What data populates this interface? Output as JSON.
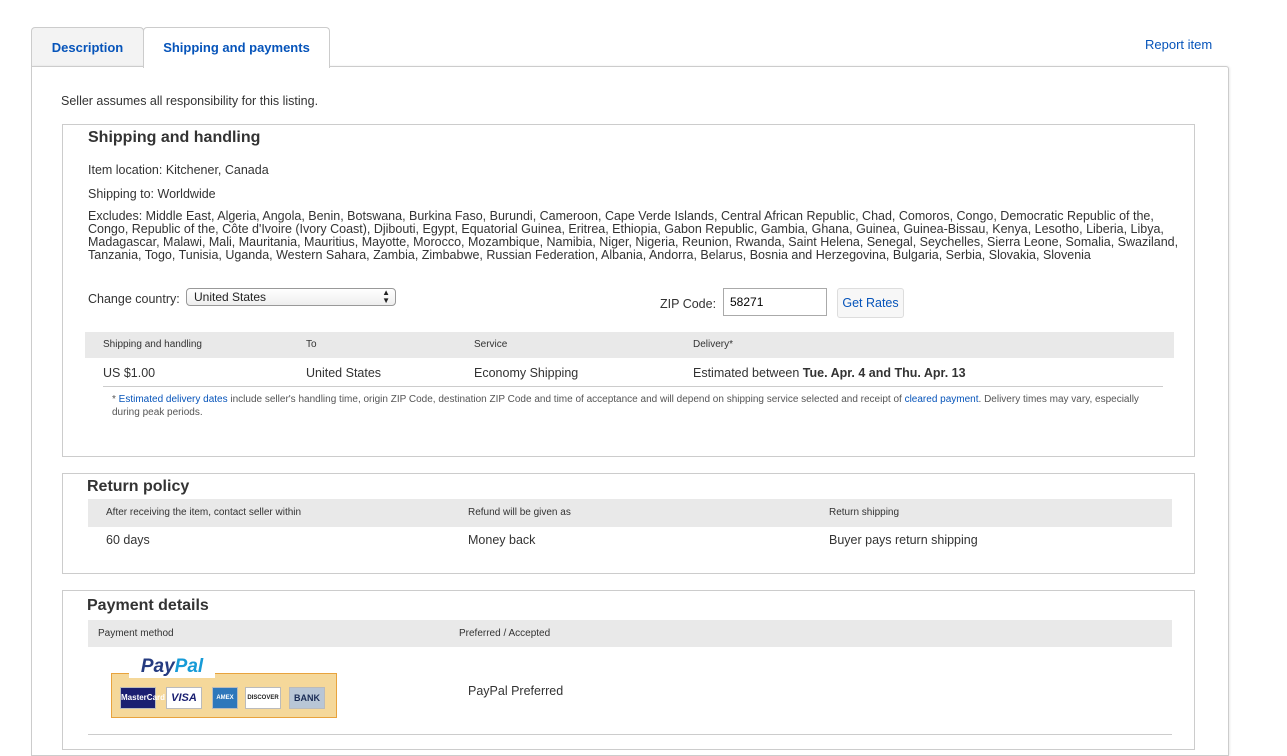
{
  "tabs": [
    {
      "label": "Description"
    },
    {
      "label": "Shipping and payments"
    }
  ],
  "report_link": "Report item",
  "seller_note": "Seller assumes all responsibility for this listing.",
  "shipping": {
    "title": "Shipping and handling",
    "item_location": "Item location: Kitchener, Canada",
    "shipping_to": "Shipping to: Worldwide",
    "excludes": "Excludes: Middle East, Algeria, Angola, Benin, Botswana, Burkina Faso, Burundi, Cameroon, Cape Verde Islands, Central African Republic, Chad, Comoros, Congo, Democratic Republic of the, Congo, Republic of the, Côte d'Ivoire (Ivory Coast), Djibouti, Egypt, Equatorial Guinea, Eritrea, Ethiopia, Gabon Republic, Gambia, Ghana, Guinea, Guinea-Bissau, Kenya, Lesotho, Liberia, Libya, Madagascar, Malawi, Mali, Mauritania, Mauritius, Mayotte, Morocco, Mozambique, Namibia, Niger, Nigeria, Reunion, Rwanda, Saint Helena, Senegal, Seychelles, Sierra Leone, Somalia, Swaziland, Tanzania, Togo, Tunisia, Uganda, Western Sahara, Zambia, Zimbabwe, Russian Federation, Albania, Andorra, Belarus, Bosnia and Herzegovina, Bulgaria, Serbia, Slovakia, Slovenia",
    "change_country_label": "Change country:",
    "country_selected": "United States",
    "zip_label": "ZIP Code:",
    "zip_value": "58271",
    "get_rates": "Get Rates",
    "headers": [
      "Shipping and handling",
      "To",
      "Service",
      "Delivery*"
    ],
    "row": {
      "price": "US $1.00",
      "to": "United States",
      "service": "Economy Shipping",
      "delivery_prefix": "Estimated between",
      "delivery_dates": "Tue. Apr. 4 and Thu. Apr. 13"
    },
    "footnote_star": "* ",
    "footnote_link1": "Estimated delivery dates",
    "footnote_mid": " include seller's handling time, origin ZIP Code, destination ZIP Code and time of acceptance and will depend on shipping service selected and receipt of ",
    "footnote_link2": "cleared payment",
    "footnote_end": ". Delivery times may vary, especially during peak periods."
  },
  "returns": {
    "title": "Return policy",
    "headers": [
      "After receiving the item, contact seller within",
      "Refund will be given as",
      "Return shipping"
    ],
    "row": [
      "60 days",
      "Money back",
      "Buyer pays return shipping"
    ]
  },
  "payment": {
    "title": "Payment details",
    "headers": [
      "Payment method",
      "Preferred / Accepted"
    ],
    "logo_text_1": "Pay",
    "logo_text_2": "Pal",
    "cards": [
      "MasterCard",
      "VISA",
      "AMEX",
      "DISCOVER",
      "BANK"
    ],
    "preferred": "PayPal Preferred"
  },
  "colors": {
    "link": "#0654ba",
    "header_bg": "#e9e9e9",
    "border": "#cccccc"
  }
}
